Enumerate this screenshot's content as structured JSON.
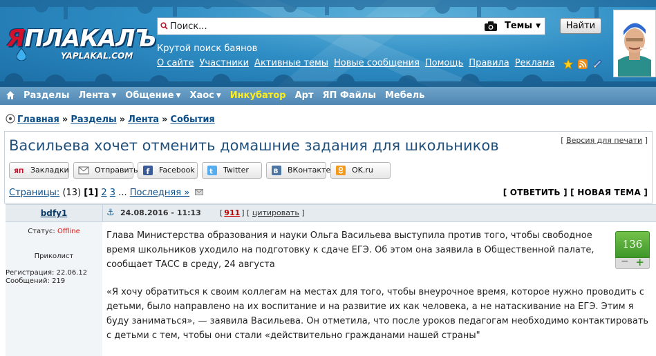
{
  "header": {
    "logo_text_ya": "Я",
    "logo_text_rest": "ПЛАКАЛЪ",
    "logo_sub": "YAPLAKAL.COM",
    "search_placeholder": "Поиск...",
    "search_select": "Темы",
    "search_button": "Найти",
    "tagline": "Крутой поиск баянов",
    "links": [
      "О сайте",
      "Участники",
      "Активные темы",
      "Новые сообщения",
      "Помощь",
      "Правила",
      "Реклама"
    ],
    "icons": [
      "star-icon",
      "rss-icon",
      "pencil-icon"
    ]
  },
  "nav": {
    "items": [
      {
        "label": "Разделы",
        "dropdown": false,
        "highlight": false
      },
      {
        "label": "Лента",
        "dropdown": true,
        "highlight": false
      },
      {
        "label": "Общение",
        "dropdown": true,
        "highlight": false
      },
      {
        "label": "Хаос",
        "dropdown": true,
        "highlight": false
      },
      {
        "label": "Инкубатор",
        "dropdown": false,
        "highlight": true
      },
      {
        "label": "Арт",
        "dropdown": false,
        "highlight": false
      },
      {
        "label": "ЯП Файлы",
        "dropdown": false,
        "highlight": false
      },
      {
        "label": "Мебель",
        "dropdown": false,
        "highlight": false
      }
    ],
    "highlight_color": "#ffee1c"
  },
  "breadcrumb": [
    "Главная",
    "Разделы",
    "Лента",
    "События"
  ],
  "breadcrumb_sep": "»",
  "topic": {
    "title": "Васильева хочет отменить домашние задания для школьников",
    "print_link": "Версия для печати",
    "share": [
      {
        "label": "Закладки",
        "icon": "yap-icon"
      },
      {
        "label": "Отправить",
        "icon": "mail-icon"
      },
      {
        "label": "Facebook",
        "icon": "facebook-icon"
      },
      {
        "label": "Twitter",
        "icon": "twitter-icon"
      },
      {
        "label": "ВКонтакте",
        "icon": "vk-icon"
      },
      {
        "label": "OK.ru",
        "icon": "ok-icon"
      }
    ],
    "pages_label": "Страницы:",
    "pages_count": "(13)",
    "current_page": "[1]",
    "page_links": [
      "2",
      "3"
    ],
    "ellipsis": "...",
    "last_page": "Последняя »",
    "reply_button": "ОТВЕТИТЬ",
    "new_topic_button": "НОВАЯ ТЕМА"
  },
  "post": {
    "author": "bdfy1",
    "date": "24.08.2016 - 11:13",
    "number": "911",
    "quote_link": "цитировать",
    "status_label": "Статус:",
    "status_value": "Offline",
    "rank": "Приколист",
    "reg_label": "Регистрация:",
    "reg_value": "22.06.12",
    "msgs_label": "Сообщений:",
    "msgs_value": "219",
    "rating": "136",
    "paragraphs": [
      "Глава Министерства образования и науки Ольга Васильева выступила против того, чтобы свободное время школьников уходило на подготовку к сдаче ЕГЭ. Об этом она заявила в Общественной палате, сообщает ТАСС в среду, 24 августа",
      "«Я хочу обратиться к своим коллегам на местах для того, чтобы внеурочное время, которое нужно проводить с детьми, было направлено на их воспитание и на развитие их как человека, а не натаскивание на ЕГЭ. Этим я буду заниматься», — заявила Васильева. Он отметила, что после уроков педагогам необходимо контактировать с детьми с тем, чтобы они стали «действительно гражданами нашей страны\""
    ]
  }
}
